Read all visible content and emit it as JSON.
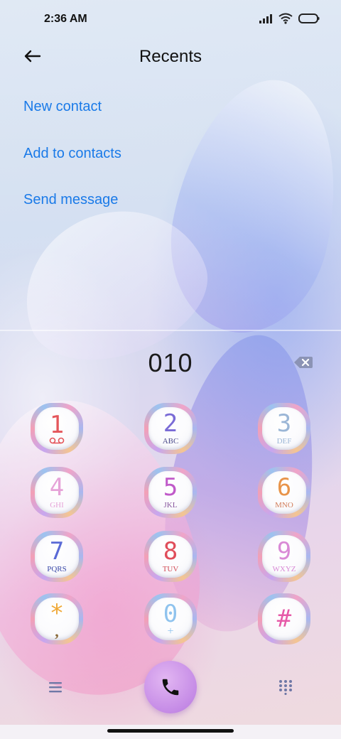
{
  "status_bar": {
    "time": "2:36 AM"
  },
  "header": {
    "title": "Recents"
  },
  "actions": [
    {
      "label": "New contact"
    },
    {
      "label": "Add to contacts"
    },
    {
      "label": "Send message"
    }
  ],
  "dialer": {
    "number": "010",
    "keys": [
      {
        "digit": "1",
        "sub": "",
        "color": "#e4565b",
        "sub_color": "#e4565b"
      },
      {
        "digit": "2",
        "sub": "ABC",
        "color": "#7a6bd6",
        "sub_color": "#4a4a8a"
      },
      {
        "digit": "3",
        "sub": "DEF",
        "color": "#9bb6d6",
        "sub_color": "#9bb6d6"
      },
      {
        "digit": "4",
        "sub": "GHI",
        "color": "#e6a3d8",
        "sub_color": "#e6a3d8"
      },
      {
        "digit": "5",
        "sub": "JKL",
        "color": "#c05ac9",
        "sub_color": "#8a5aa0"
      },
      {
        "digit": "6",
        "sub": "MNO",
        "color": "#e8944a",
        "sub_color": "#d27d5a"
      },
      {
        "digit": "7",
        "sub": "PQRS",
        "color": "#5a6ad6",
        "sub_color": "#3b4aa8"
      },
      {
        "digit": "8",
        "sub": "TUV",
        "color": "#e04d5a",
        "sub_color": "#d04a55"
      },
      {
        "digit": "9",
        "sub": "WXYZ",
        "color": "#d98ad6",
        "sub_color": "#d98ad6"
      },
      {
        "digit": "*",
        "sub": ",",
        "color": "#f0a938",
        "sub_color": "#8a6a3a"
      },
      {
        "digit": "0",
        "sub": "+",
        "color": "#8fc3ee",
        "sub_color": "#8fc3ee"
      },
      {
        "digit": "#",
        "sub": "",
        "color": "#e65aa8",
        "sub_color": "#e65aa8"
      }
    ]
  },
  "icons": {
    "back": "arrow-left-icon",
    "backspace": "backspace-icon",
    "call": "phone-icon",
    "menu": "menu-icon",
    "keypad": "keypad-icon"
  }
}
